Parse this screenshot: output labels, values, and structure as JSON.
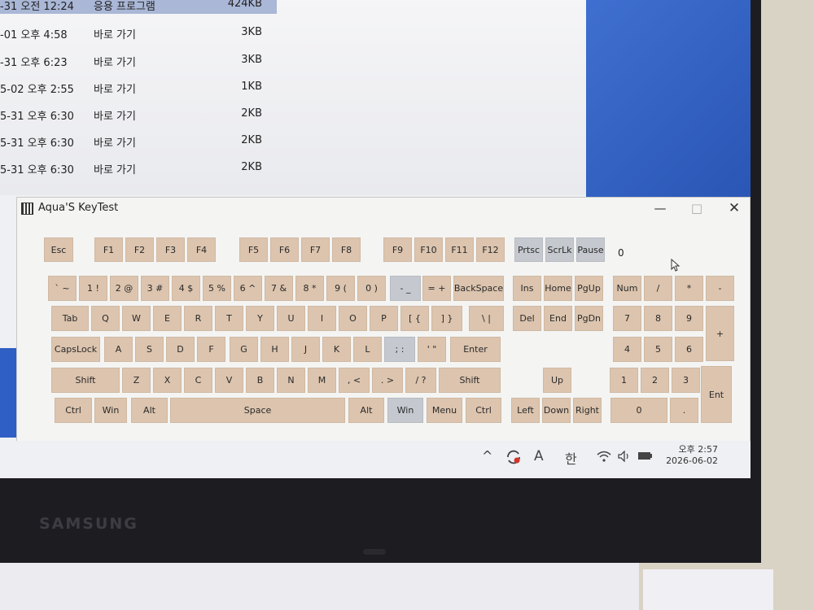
{
  "explorer": {
    "rows": [
      {
        "date": "-31 오전 12:24",
        "type": "응용 프로그램",
        "size": "424KB"
      },
      {
        "date": "-01 오후 4:58",
        "type": "바로 가기",
        "size": "3KB"
      },
      {
        "date": "-31 오후 6:23",
        "type": "바로 가기",
        "size": "3KB"
      },
      {
        "date": "5-02 오후 2:55",
        "type": "바로 가기",
        "size": "1KB"
      },
      {
        "date": "5-31 오후 6:30",
        "type": "바로 가기",
        "size": "2KB"
      },
      {
        "date": "5-31 오후 6:30",
        "type": "바로 가기",
        "size": "2KB"
      },
      {
        "date": "5-31 오후 6:30",
        "type": "바로 가기",
        "size": "2KB"
      }
    ]
  },
  "window": {
    "title": "Aqua'S KeyTest",
    "minimize": "—",
    "maximize": "□",
    "close": "✕"
  },
  "counter": "0",
  "keys": {
    "esc": "Esc",
    "f1": "F1",
    "f2": "F2",
    "f3": "F3",
    "f4": "F4",
    "f5": "F5",
    "f6": "F6",
    "f7": "F7",
    "f8": "F8",
    "f9": "F9",
    "f10": "F10",
    "f11": "F11",
    "f12": "F12",
    "prtsc": "Prtsc",
    "scrlk": "ScrLk",
    "pause": "Pause",
    "backtick": "` ~",
    "1": "1 !",
    "2": "2 @",
    "3": "3 #",
    "4": "4 $",
    "5": "5 %",
    "6": "6 ^",
    "7": "7 &",
    "8": "8 *",
    "9": "9 (",
    "0": "0 )",
    "minus": "- _",
    "equals": "= +",
    "backspace": "BackSpace",
    "ins": "Ins",
    "home": "Home",
    "pgup": "PgUp",
    "num": "Num",
    "kp_div": "/",
    "kp_mul": "*",
    "kp_sub": "-",
    "tab": "Tab",
    "q": "Q",
    "w": "W",
    "e": "E",
    "r": "R",
    "t": "T",
    "y": "Y",
    "u": "U",
    "i": "I",
    "o": "O",
    "p": "P",
    "lbracket": "[ {",
    "rbracket": "] }",
    "backslash": "\\ |",
    "del": "Del",
    "end": "End",
    "pgdn": "PgDn",
    "kp7": "7",
    "kp8": "8",
    "kp9": "9",
    "kp_add": "+",
    "capslock": "CapsLock",
    "a": "A",
    "s": "S",
    "d": "D",
    "f": "F",
    "g": "G",
    "h": "H",
    "j": "J",
    "k": "K",
    "l": "L",
    "semicolon": "; :",
    "quote": "' \"",
    "enter": "Enter",
    "kp4": "4",
    "kp5": "5",
    "kp6": "6",
    "lshift": "Shift",
    "z": "Z",
    "x": "X",
    "c": "C",
    "v": "V",
    "b": "B",
    "n": "N",
    "m": "M",
    "comma": ", <",
    "period": ". >",
    "slash": "/ ?",
    "rshift": "Shift",
    "up": "Up",
    "kp1": "1",
    "kp2": "2",
    "kp3": "3",
    "kp_enter": "Ent",
    "lctrl": "Ctrl",
    "lwin": "Win",
    "lalt": "Alt",
    "space": "Space",
    "ralt": "Alt",
    "rwin": "Win",
    "menu": "Menu",
    "rctrl": "Ctrl",
    "left": "Left",
    "down": "Down",
    "right": "Right",
    "kp0": "0",
    "kp_dot": "."
  },
  "taskbar": {
    "chevron": "^",
    "ime_letter": "A",
    "ime_korean": "한",
    "time": "오후 2:57",
    "date": "2026-06-02"
  },
  "brand": "SAMSUNG",
  "icons": {
    "tray": [
      "chevron-up-icon",
      "sync-icon",
      "wifi-icon",
      "speaker-icon",
      "battery-icon"
    ],
    "pointer": "mouse-pointer-icon"
  },
  "colors": {
    "key_pressed": "#dcc4ae",
    "key_gray": "#c5c9cf",
    "desktop_blue": "#2f5ec4"
  }
}
